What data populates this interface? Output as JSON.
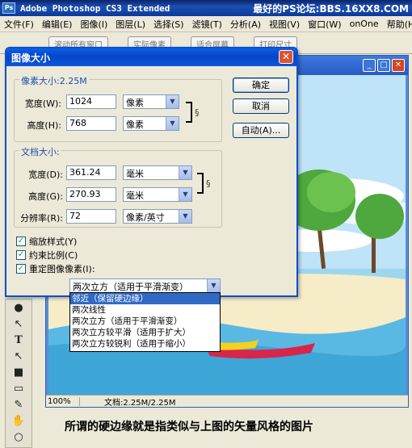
{
  "app": {
    "logo_text": "Ps",
    "title": "Adobe Photoshop CS3 Extended",
    "watermark": "最好的PS论坛:BBS.16XX8.COM"
  },
  "menubar": {
    "items": [
      "文件(F)",
      "编辑(E)",
      "图像(I)",
      "图层(L)",
      "选择(S)",
      "滤镜(T)",
      "分析(A)",
      "视图(V)",
      "窗口(W)",
      "onOne",
      "帮助(H)"
    ]
  },
  "optionsbar": {
    "items": [
      "滚动所有窗口",
      "实际像素",
      "适合屏幕",
      "打印尺寸"
    ]
  },
  "document": {
    "zoom": "100%",
    "doc_size": "文档:2.25M/2.25M",
    "controls": {
      "min": "_",
      "max": "□",
      "close": "✕"
    }
  },
  "dialog": {
    "title": "图像大小",
    "close_label": "✕",
    "pixel_dimensions": {
      "legend": "像素大小:2.25M",
      "width_label": "宽度(W):",
      "width_value": "1024",
      "width_unit": "像素",
      "height_label": "高度(H):",
      "height_value": "768",
      "height_unit": "像素"
    },
    "document_size": {
      "legend": "文档大小:",
      "width_label": "宽度(D):",
      "width_value": "361.24",
      "width_unit": "毫米",
      "height_label": "高度(G):",
      "height_value": "270.93",
      "height_unit": "毫米",
      "resolution_label": "分辨率(R):",
      "resolution_value": "72",
      "resolution_unit": "像素/英寸"
    },
    "buttons": {
      "ok": "确定",
      "cancel": "取消",
      "auto": "自动(A)..."
    },
    "options": {
      "scale_styles": "缩放样式(Y)",
      "constrain": "约束比例(C)",
      "resample": "重定图像像素(I):"
    },
    "resample_method": {
      "selected": "两次立方（适用于平滑渐变）",
      "options": [
        "邻近（保留硬边缘）",
        "两次线性",
        "两次立方（适用于平滑渐变）",
        "两次立方较平滑（适用于扩大）",
        "两次立方较锐利（适用于缩小）"
      ],
      "highlighted_index": 0
    }
  },
  "caption": "所谓的硬边缘就是指类似与上图的矢量风格的图片",
  "colors": {
    "xp_blue": "#0546c4",
    "highlight": "#316ac5",
    "legend_blue": "#1d4eb0"
  }
}
